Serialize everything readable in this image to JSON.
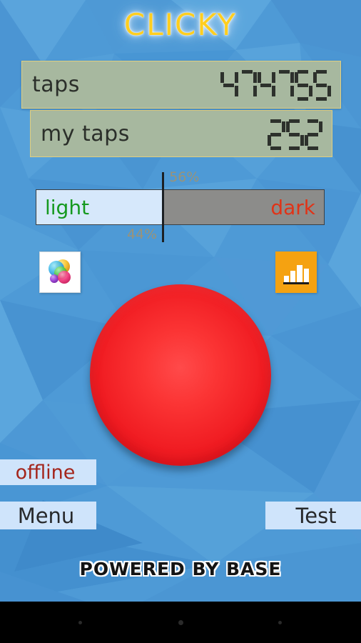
{
  "app": {
    "title": "CLICKY",
    "footer": "POWERED BY BASE"
  },
  "stats": {
    "global": {
      "label": "taps",
      "value": "474755"
    },
    "personal": {
      "label": "my taps",
      "value": "252"
    }
  },
  "ratio": {
    "light_label": "light",
    "dark_label": "dark",
    "light_percent": "44%",
    "dark_percent": "56%",
    "light_value": 44,
    "dark_value": 56,
    "light_color": "#15991f",
    "dark_color": "#e03317",
    "light_fill": "#d6e8fb",
    "dark_fill": "#8c8c8a"
  },
  "icons": {
    "game_center": "game-center-bubbles-icon",
    "leaderboard": "bar-chart-icon"
  },
  "tap_button": {
    "name": "tap-button",
    "color": "#f01c22"
  },
  "buttons": {
    "offline": "offline",
    "menu": "Menu",
    "test": "Test"
  },
  "navbar": {
    "back": "back-dot",
    "home": "home-dot",
    "recent": "recent-dot"
  },
  "colors": {
    "background": "#4e9ad6",
    "panel": "#a7b89f",
    "panel_border": "#e0cf80",
    "title": "#FFCE1F",
    "button_face": "#cfe4fb",
    "offline_text": "#a4251b"
  }
}
